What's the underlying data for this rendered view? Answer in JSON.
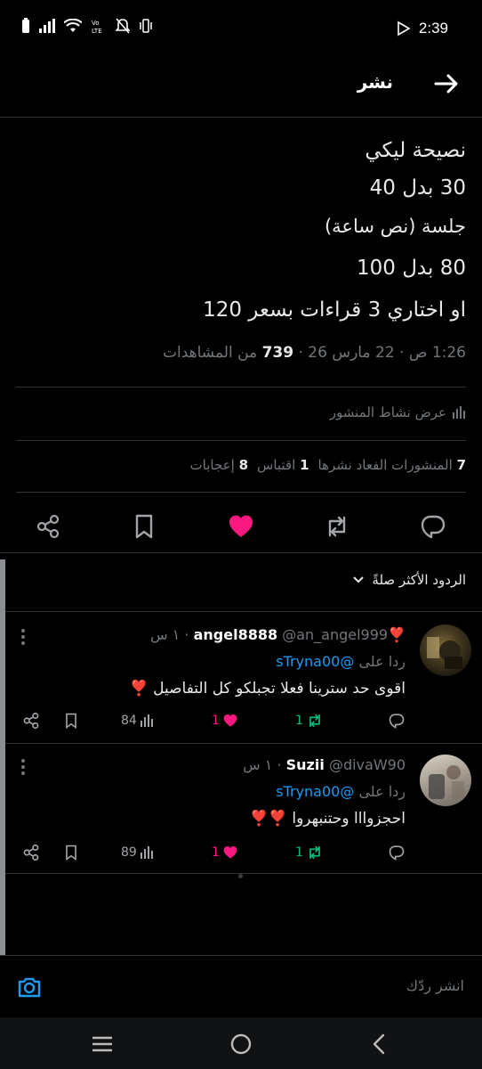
{
  "status_bar": {
    "time": "2:39"
  },
  "header": {
    "title": "نشر"
  },
  "post": {
    "lines": [
      "نصيحة ليكي",
      "30 بدل 40",
      "جلسة (نص ساعة)",
      "80  بدل 100",
      "او اختاري 3 قراءات بسعر 120"
    ],
    "meta_date": "1:26 ص · 22 مارس 26 ·",
    "views_count": "739",
    "views_label": "من المشاهدات"
  },
  "activity_label": "عرض نشاط المنشور",
  "stats": {
    "reposts_count": "7",
    "reposts_label": "المنشورات الفعاد نشرها",
    "quotes_count": "1",
    "quotes_label": "اقتباس",
    "likes_count": "8",
    "likes_label": "إعجابات"
  },
  "sort_label": "الردود الأكثر صلةً",
  "replies": [
    {
      "name": "angel8888",
      "name_emoji": "❣️",
      "handle": "@an_angel999",
      "time": "· ١ س",
      "reply_to_label": "ردا على",
      "reply_to_handle": "@sTryna00",
      "text": "اقوى حد سترينا فعلا تجبلكو كل التفاصيل ❣️",
      "replies_count": "",
      "reposts_count": "1",
      "likes_count": "1",
      "views_count": "84"
    },
    {
      "name": "Suzii",
      "name_emoji": "",
      "handle": "@divaW90",
      "time": "· ١ س",
      "reply_to_label": "ردا على",
      "reply_to_handle": "@sTryna00",
      "text": "احجزوااا وحتنبهروا ❣️❣️",
      "replies_count": "",
      "reposts_count": "1",
      "likes_count": "1",
      "views_count": "89"
    }
  ],
  "compose": {
    "placeholder": "انشر ردّك"
  },
  "colors": {
    "background": "#000000",
    "text": "#e7e9ea",
    "muted": "#71767b",
    "accent": "#1d9bf0",
    "like": "#f91880",
    "repost": "#00ba7c",
    "divider": "#2f3336"
  }
}
